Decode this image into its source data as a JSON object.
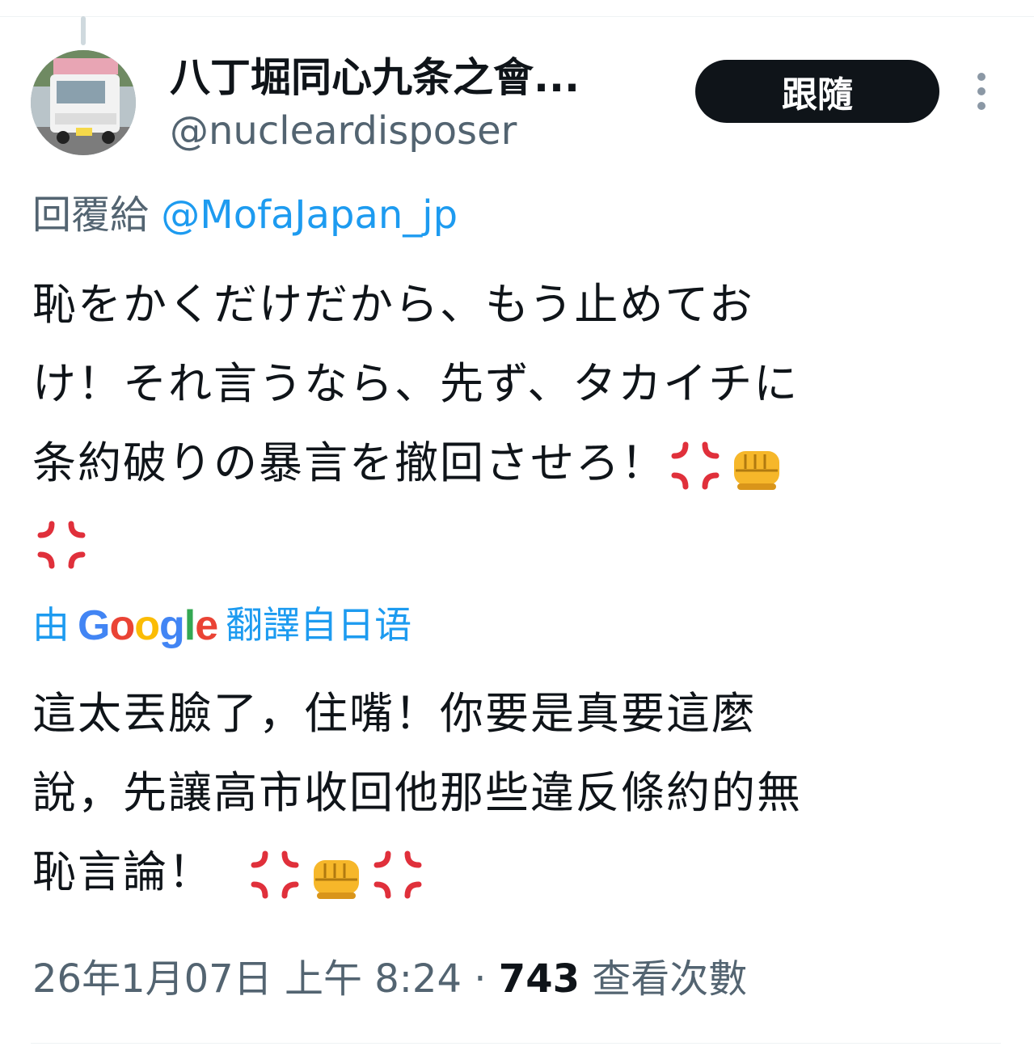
{
  "tweet": {
    "display_name": "八丁堀同心九条之會...",
    "handle": "@nucleardisposer",
    "follow_label": "跟隨",
    "more_icon": "more-vertical-icon",
    "reply_prefix": "回覆給",
    "reply_mention": "@MofaJapan_jp",
    "text_lines": [
      "恥をかくだけだから、もう止めてお",
      "け！それ言うなら、先ず、タカイチに",
      "条約破りの暴言を撤回させろ！"
    ],
    "text_emojis": [
      "anger-symbol",
      "oncoming-fist",
      "anger-symbol"
    ],
    "translate": {
      "prefix": "由",
      "google_letters": [
        "G",
        "o",
        "o",
        "g",
        "l",
        "e"
      ],
      "suffix": "翻譯自日语"
    },
    "translated_lines": [
      "這太丟臉了，住嘴！你要是真要這麼",
      "說，先讓高市收回他那些違反條約的無",
      "恥言論！"
    ],
    "translated_emojis": [
      "anger-symbol",
      "oncoming-fist",
      "anger-symbol"
    ],
    "timestamp": "26年1月07日 上午 8:24",
    "separator": " · ",
    "view_count": "743",
    "view_label": "查看次數"
  },
  "colors": {
    "text": "#0f1419",
    "secondary": "#536471",
    "link": "#1d9bf0",
    "button_bg": "#0f1419",
    "anger": "#e0303b",
    "fist": "#f6b72a"
  }
}
